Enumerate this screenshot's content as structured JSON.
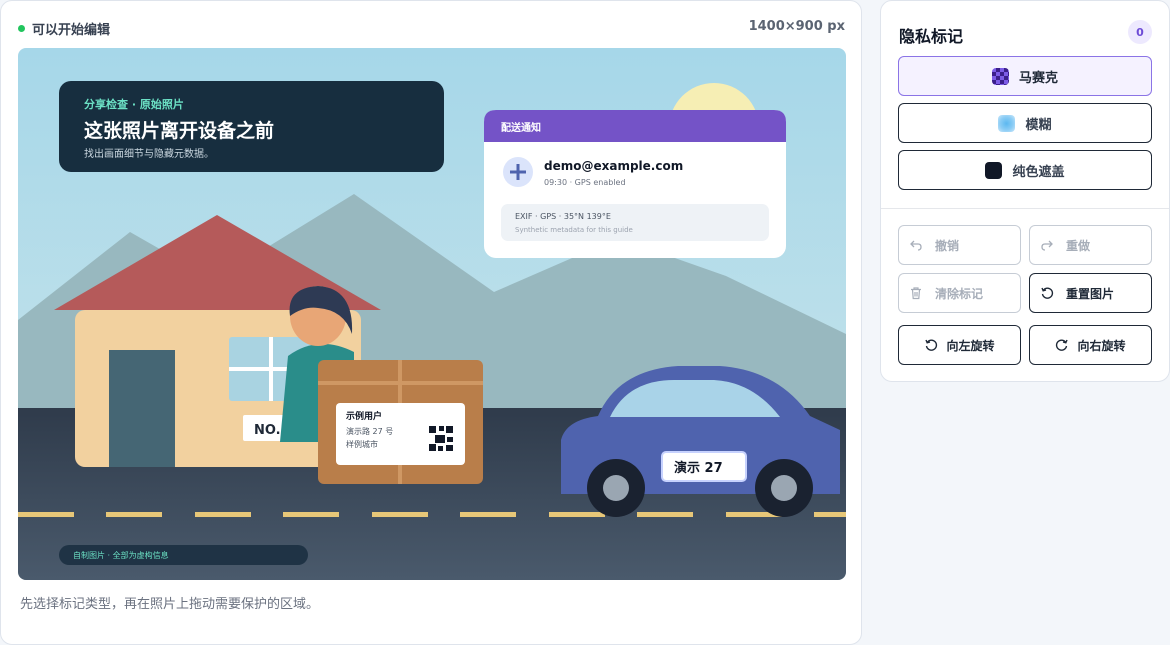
{
  "editor": {
    "status_text": "可以开始编辑",
    "status_color": "#22c55e",
    "dimensions": "1400×900 px",
    "hint": "先选择标记类型，再在照片上拖动需要保护的区域。"
  },
  "photo": {
    "banner_kicker": "分享检查 · 原始照片",
    "banner_title": "这张照片离开设备之前",
    "banner_subtitle": "找出画面细节与隐藏元数据。",
    "notification_header": "配送通知",
    "notification_email": "demo@example.com",
    "notification_time": "09:30 · GPS enabled",
    "exif_line": "EXIF · GPS · 35°N 139°E",
    "exif_note": "Synthetic metadata for this guide",
    "house_number": "NO.",
    "parcel_name": "示例用户",
    "parcel_address": "演示路 27 号",
    "parcel_city": "样例城市",
    "license_plate": "演示 27",
    "footer_note": "自制图片 · 全部为虚构信息"
  },
  "panel": {
    "title": "隐私标记",
    "count": "0",
    "accent": "#8b74e6",
    "mark_types": [
      {
        "label": "马赛克",
        "icon": "mosaic-swatch-icon",
        "active": true
      },
      {
        "label": "模糊",
        "icon": "blur-swatch-icon",
        "active": false
      },
      {
        "label": "纯色遮盖",
        "icon": "solid-swatch-icon",
        "active": false
      }
    ],
    "actions": {
      "undo": "撤销",
      "redo": "重做",
      "clear": "清除标记",
      "reset": "重置图片",
      "rotate_left": "向左旋转",
      "rotate_right": "向右旋转"
    }
  }
}
